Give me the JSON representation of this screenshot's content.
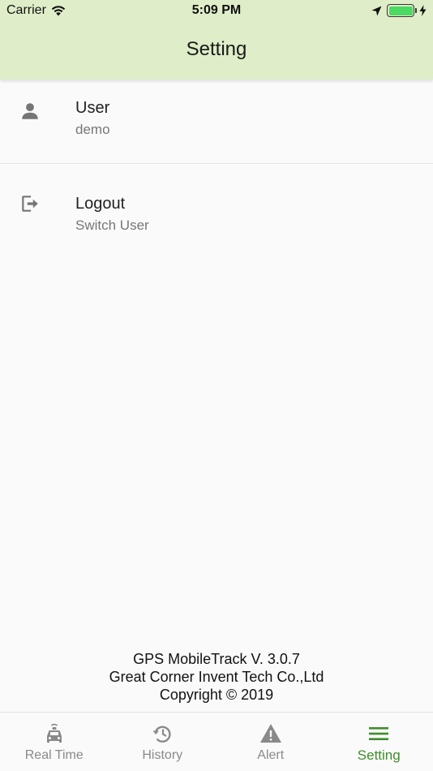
{
  "status_bar": {
    "carrier": "Carrier",
    "time": "5:09 PM"
  },
  "header": {
    "title": "Setting",
    "background": "#dfedc8"
  },
  "settings_list": [
    {
      "icon": "person-icon",
      "primary": "User",
      "secondary": "demo"
    },
    {
      "icon": "logout-icon",
      "primary": "Logout",
      "secondary": "Switch User"
    }
  ],
  "footer": {
    "version": "GPS MobileTrack V. 3.0.7",
    "company": "Great Corner Invent Tech Co.,Ltd",
    "copyright": "Copyright © 2019"
  },
  "tabs": [
    {
      "icon": "car-icon",
      "label": "Real Time",
      "active": false
    },
    {
      "icon": "history-icon",
      "label": "History",
      "active": false
    },
    {
      "icon": "alert-icon",
      "label": "Alert",
      "active": false
    },
    {
      "icon": "menu-icon",
      "label": "Setting",
      "active": true
    }
  ],
  "colors": {
    "accent": "#3e8e2c",
    "inactive": "#8a8a8a"
  }
}
